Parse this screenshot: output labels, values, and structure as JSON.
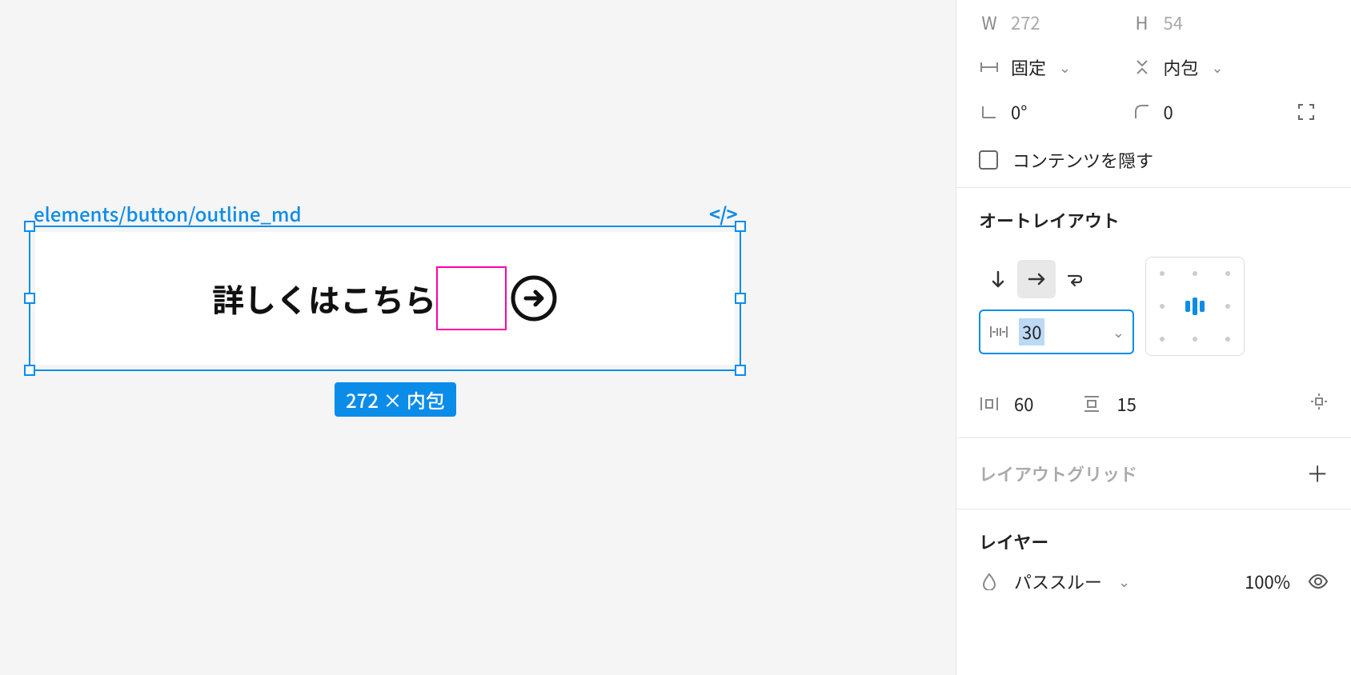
{
  "canvas": {
    "component_name": "elements/button/outline_md",
    "dev_badge": "</>",
    "button_text": "詳しくはこちら",
    "dimensions_badge": "272 × 内包"
  },
  "panel": {
    "size": {
      "w_label": "W",
      "w_value": "272",
      "h_label": "H",
      "h_value": "54"
    },
    "width_mode": "固定",
    "height_mode": "内包",
    "rotation": "0°",
    "corner_radius": "0",
    "clip_content": "コンテンツを隠す",
    "autolayout": {
      "title": "オートレイアウト",
      "spacing": "30",
      "h_padding": "60",
      "v_padding": "15"
    },
    "layout_grid": {
      "title": "レイアウトグリッド"
    },
    "layer": {
      "title": "レイヤー",
      "blend_mode": "パススルー",
      "opacity": "100%"
    }
  }
}
